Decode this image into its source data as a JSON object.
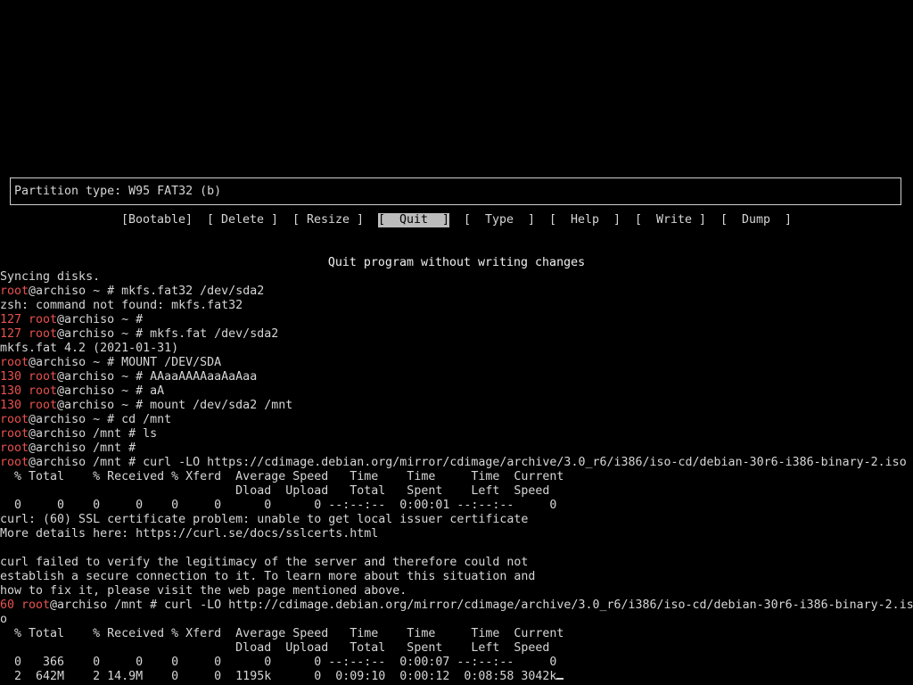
{
  "cfdisk": {
    "partition_type": "Partition type: W95 FAT32 (b)",
    "menu": [
      {
        "label": "[Bootable]"
      },
      {
        "label": "[ Delete ]"
      },
      {
        "label": "[ Resize ]"
      },
      {
        "label": "[  Quit  ]",
        "selected": true
      },
      {
        "label": "[  Type  ]"
      },
      {
        "label": "[  Help  ]"
      },
      {
        "label": "[  Write ]"
      },
      {
        "label": "[  Dump  ]"
      }
    ],
    "description": "Quit program without writing changes"
  },
  "terminal": {
    "lines": [
      {
        "segments": [
          {
            "text": "Syncing disks."
          }
        ]
      },
      {
        "segments": [
          {
            "text": "root",
            "cls": "red"
          },
          {
            "text": "@archiso ~ # mkfs.fat32 /dev/sda2"
          }
        ]
      },
      {
        "segments": [
          {
            "text": "zsh: command not found: mkfs.fat32"
          }
        ]
      },
      {
        "segments": [
          {
            "text": "127 root",
            "cls": "red"
          },
          {
            "text": "@archiso ~ #"
          }
        ]
      },
      {
        "segments": [
          {
            "text": "127 root",
            "cls": "red"
          },
          {
            "text": "@archiso ~ # mkfs.fat /dev/sda2"
          }
        ]
      },
      {
        "segments": [
          {
            "text": "mkfs.fat 4.2 (2021-01-31)"
          }
        ]
      },
      {
        "segments": [
          {
            "text": "root",
            "cls": "red"
          },
          {
            "text": "@archiso ~ # MOUNT /DEV/SDA"
          }
        ]
      },
      {
        "segments": [
          {
            "text": "130 root",
            "cls": "red"
          },
          {
            "text": "@archiso ~ # AAaaAAAAaaAaAaa"
          }
        ]
      },
      {
        "segments": [
          {
            "text": "130 root",
            "cls": "red"
          },
          {
            "text": "@archiso ~ # aA"
          }
        ]
      },
      {
        "segments": [
          {
            "text": "130 root",
            "cls": "red"
          },
          {
            "text": "@archiso ~ # mount /dev/sda2 /mnt"
          }
        ]
      },
      {
        "segments": [
          {
            "text": "root",
            "cls": "red"
          },
          {
            "text": "@archiso ~ # cd /mnt"
          }
        ]
      },
      {
        "segments": [
          {
            "text": "root",
            "cls": "red"
          },
          {
            "text": "@archiso /mnt # ls"
          }
        ]
      },
      {
        "segments": [
          {
            "text": "root",
            "cls": "red"
          },
          {
            "text": "@archiso /mnt #"
          }
        ]
      },
      {
        "segments": [
          {
            "text": "root",
            "cls": "red"
          },
          {
            "text": "@archiso /mnt # curl -LO https://cdimage.debian.org/mirror/cdimage/archive/3.0_r6/i386/iso-cd/debian-30r6-i386-binary-2.iso"
          }
        ]
      },
      {
        "segments": [
          {
            "text": "  % Total    % Received % Xferd  Average Speed   Time    Time     Time  Current"
          }
        ]
      },
      {
        "segments": [
          {
            "text": "                                 Dload  Upload   Total   Spent    Left  Speed"
          }
        ]
      },
      {
        "segments": [
          {
            "text": "  0     0    0     0    0     0      0      0 --:--:--  0:00:01 --:--:--     0"
          }
        ]
      },
      {
        "segments": [
          {
            "text": "curl: (60) SSL certificate problem: unable to get local issuer certificate"
          }
        ]
      },
      {
        "segments": [
          {
            "text": "More details here: https://curl.se/docs/sslcerts.html"
          }
        ]
      },
      {
        "segments": [
          {
            "text": ""
          }
        ]
      },
      {
        "segments": [
          {
            "text": "curl failed to verify the legitimacy of the server and therefore could not"
          }
        ]
      },
      {
        "segments": [
          {
            "text": "establish a secure connection to it. To learn more about this situation and"
          }
        ]
      },
      {
        "segments": [
          {
            "text": "how to fix it, please visit the web page mentioned above."
          }
        ]
      },
      {
        "segments": [
          {
            "text": "60 root",
            "cls": "red"
          },
          {
            "text": "@archiso /mnt # curl -LO http://cdimage.debian.org/mirror/cdimage/archive/3.0_r6/i386/iso-cd/debian-30r6-i386-binary-2.is"
          }
        ]
      },
      {
        "segments": [
          {
            "text": "o"
          }
        ]
      },
      {
        "segments": [
          {
            "text": "  % Total    % Received % Xferd  Average Speed   Time    Time     Time  Current"
          }
        ]
      },
      {
        "segments": [
          {
            "text": "                                 Dload  Upload   Total   Spent    Left  Speed"
          }
        ]
      },
      {
        "segments": [
          {
            "text": "  0   366    0     0    0     0      0      0 --:--:--  0:00:07 --:--:--     0"
          }
        ]
      },
      {
        "segments": [
          {
            "text": "  2  642M    2 14.9M    0     0  1195k      0  0:09:10  0:00:12  0:08:58 3042k"
          }
        ],
        "cursor": true
      }
    ]
  }
}
